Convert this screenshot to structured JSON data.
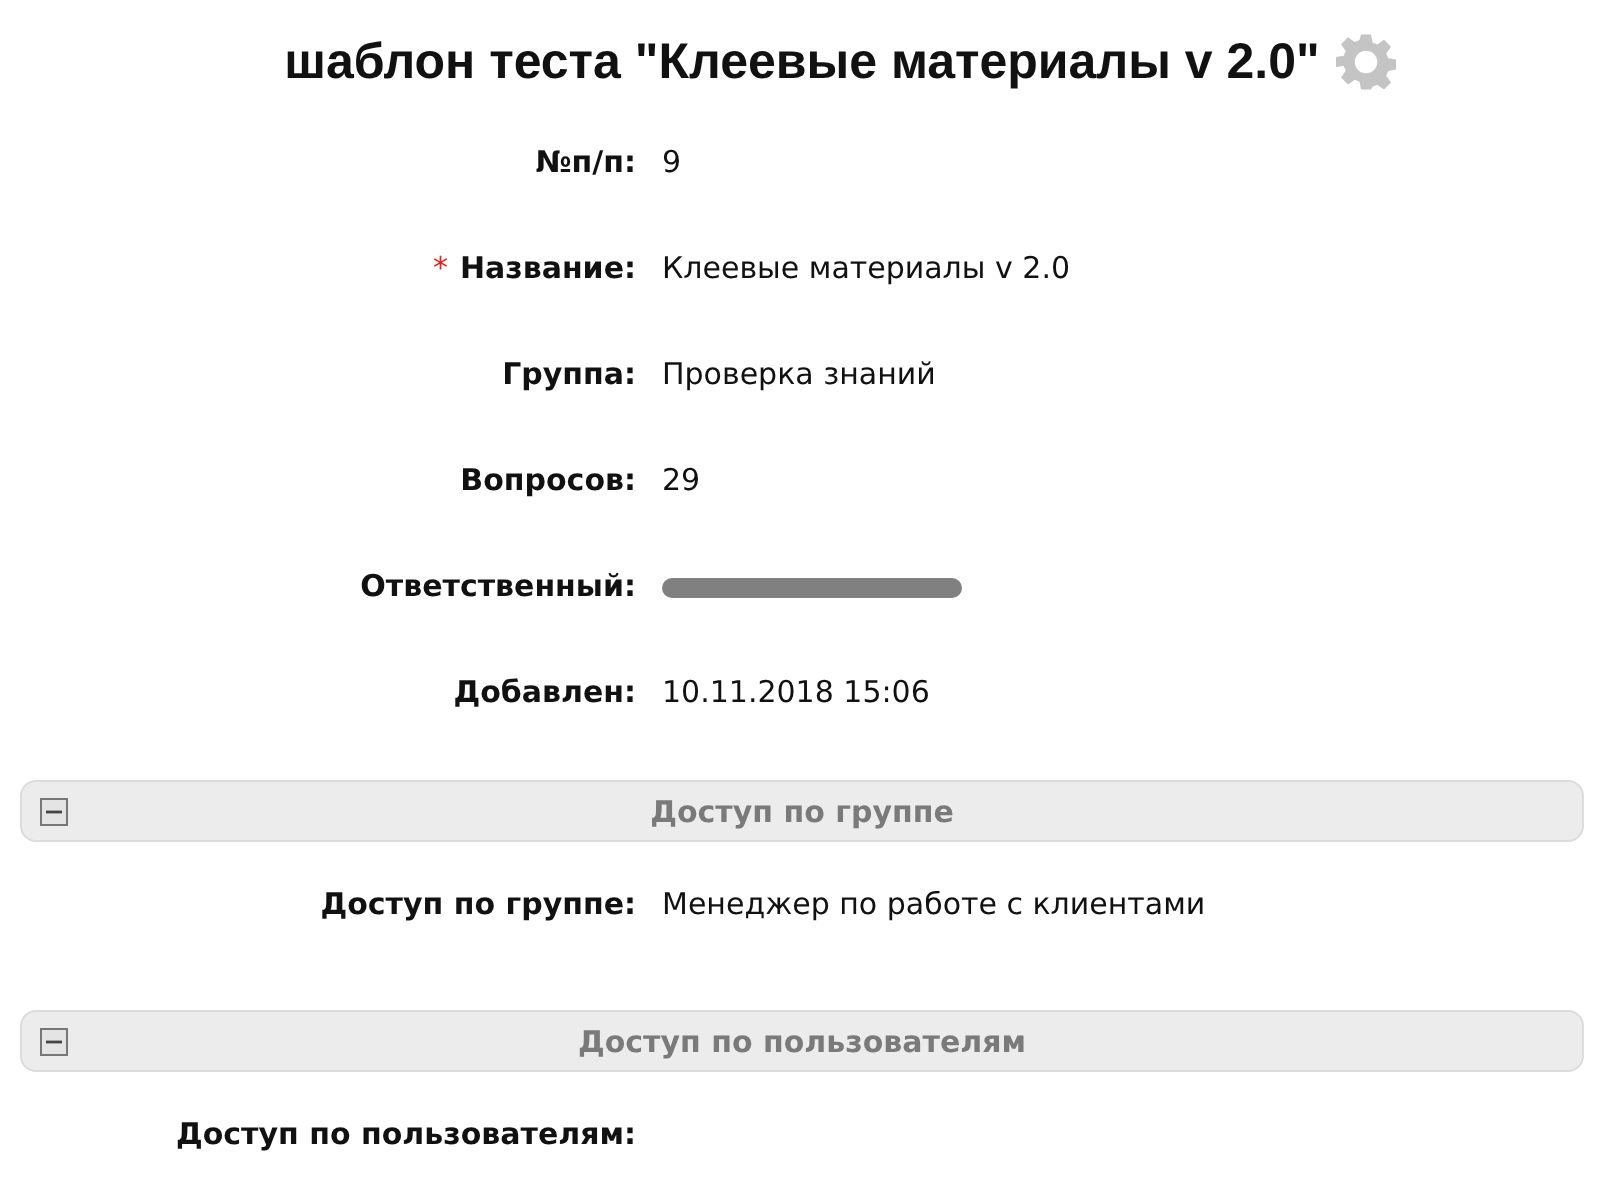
{
  "title": "шаблон теста \"Клеевые материалы v 2.0\"",
  "fields": [
    {
      "label": "№п/п:",
      "value": "9"
    },
    {
      "label": "Название:",
      "value": "Клеевые материалы v 2.0",
      "required_mark": "*"
    },
    {
      "label": "Группа:",
      "value": "Проверка знаний"
    },
    {
      "label": "Вопросов:",
      "value": "29"
    },
    {
      "label": "Ответственный:",
      "redacted": true
    },
    {
      "label": "Добавлен:",
      "value": "10.11.2018 15:06"
    }
  ],
  "sections": [
    {
      "title": "Доступ по группе",
      "expanded": true,
      "fields": [
        {
          "label": "Доступ по группе:",
          "value": "Менеджер по работе с клиентами"
        }
      ]
    },
    {
      "title": "Доступ по пользователям",
      "expanded": true,
      "fields": [
        {
          "label": "Доступ по пользователям:"
        }
      ]
    }
  ]
}
